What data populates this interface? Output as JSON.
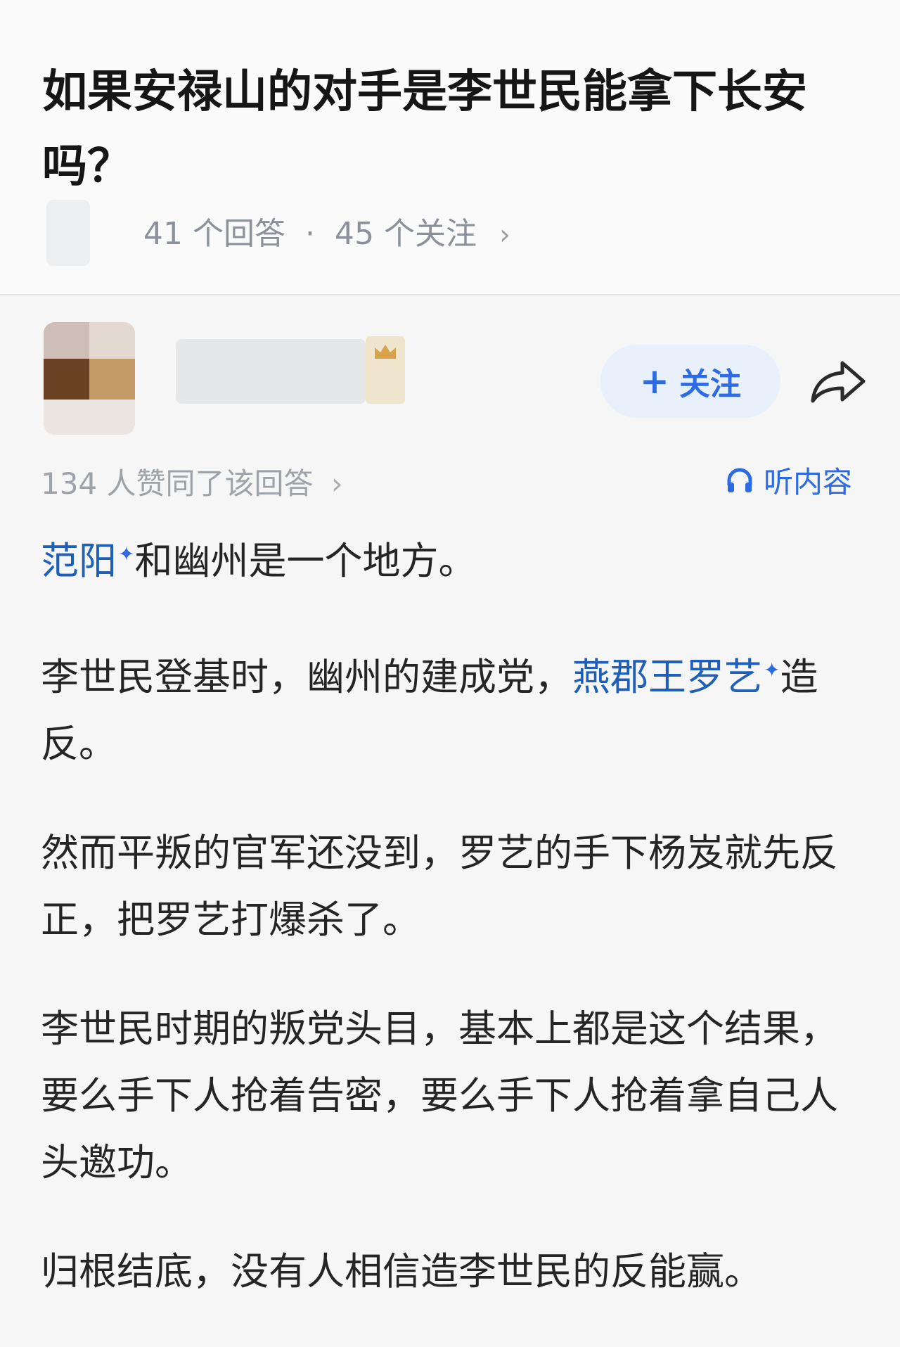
{
  "question": {
    "title": "如果安禄山的对手是李世民能拿下长安吗？",
    "answers_count": "41 个回答",
    "separator": "·",
    "followers_count": "45 个关注",
    "chevron": "›"
  },
  "author": {
    "follow_label": "关注",
    "follow_icon": "plus-icon",
    "share_icon": "share-arrow-icon"
  },
  "answer": {
    "upvote_text": "134 人赞同了该回答",
    "upvote_chevron": "›",
    "listen_label": "听内容",
    "listen_icon": "headphones-icon",
    "p1_link": "范阳",
    "p1_rest": "和幽州是一个地方。",
    "p2_text": "李世民登基时，幽州的建成党，",
    "p2_link": "燕郡王罗艺",
    "p2_rest": "造反。",
    "p3": "然而平叛的官军还没到，罗艺的手下杨岌就先反正，把罗艺打爆杀了。",
    "p4": "李世民时期的叛党头目，基本上都是这个结果，要么手下人抢着告密，要么手下人抢着拿自己人头邀功。",
    "p5": "归根结底，没有人相信造李世民的反能赢。"
  },
  "colors": {
    "accent": "#2d6be4",
    "link": "#1f5fb8",
    "muted": "#8c9199"
  }
}
